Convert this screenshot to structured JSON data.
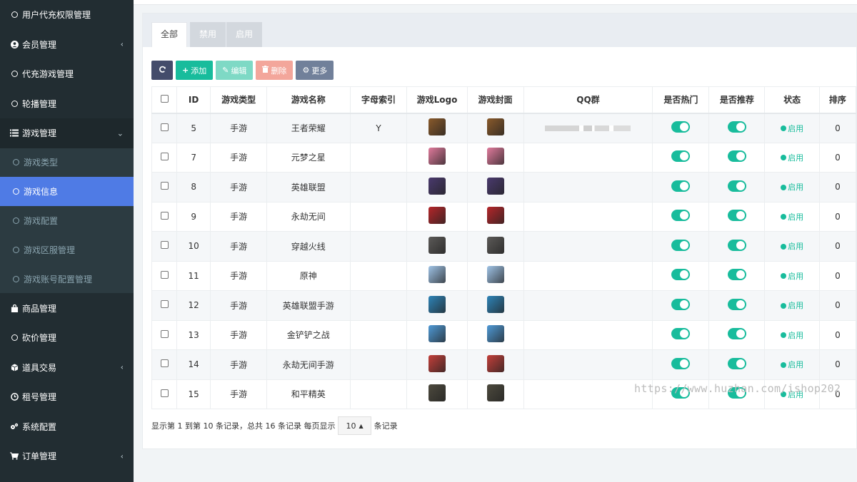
{
  "sidebar": {
    "items_top": [
      {
        "label": "用户代充权限管理",
        "icon": "circle-icon"
      },
      {
        "label": "会员管理",
        "icon": "user-circle-icon",
        "chevron": "‹"
      },
      {
        "label": "代充游戏管理",
        "icon": "circle-icon"
      },
      {
        "label": "轮播管理",
        "icon": "circle-icon"
      }
    ],
    "open_item": {
      "label": "游戏管理",
      "icon": "list-icon",
      "chevron": "⌄"
    },
    "sub_items": [
      {
        "label": "游戏类型"
      },
      {
        "label": "游戏信息",
        "active": true
      },
      {
        "label": "游戏配置"
      },
      {
        "label": "游戏区服管理"
      },
      {
        "label": "游戏账号配置管理"
      }
    ],
    "items_bottom": [
      {
        "label": "商品管理",
        "icon": "shopping-bag-icon"
      },
      {
        "label": "砍价管理",
        "icon": "circle-icon"
      },
      {
        "label": "道具交易",
        "icon": "cube-icon",
        "chevron": "‹"
      },
      {
        "label": "租号管理",
        "icon": "clock-icon"
      },
      {
        "label": "系统配置",
        "icon": "cogs-icon"
      },
      {
        "label": "订单管理",
        "icon": "cart-icon",
        "chevron": "‹"
      }
    ]
  },
  "tabs": [
    "全部",
    "禁用",
    "启用"
  ],
  "toolbar": {
    "add_label": "添加",
    "edit_label": "编辑",
    "delete_label": "删除",
    "more_label": "更多"
  },
  "table": {
    "columns": [
      "",
      "ID",
      "游戏类型",
      "游戏名称",
      "字母索引",
      "游戏Logo",
      "游戏封面",
      "QQ群",
      "是否热门",
      "是否推荐",
      "状态",
      "排序"
    ],
    "rows": [
      {
        "id": "5",
        "type": "手游",
        "name": "王者荣耀",
        "letter": "Y",
        "qq_blurred": true,
        "status": "启用",
        "sort": "0",
        "thumb_color": "#8a5a2b"
      },
      {
        "id": "7",
        "type": "手游",
        "name": "元梦之星",
        "letter": "",
        "qq_blurred": false,
        "status": "启用",
        "sort": "0",
        "thumb_color": "#e07a9c"
      },
      {
        "id": "8",
        "type": "手游",
        "name": "英雄联盟",
        "letter": "",
        "qq_blurred": false,
        "status": "启用",
        "sort": "0",
        "thumb_color": "#4a3a6e"
      },
      {
        "id": "9",
        "type": "手游",
        "name": "永劫无间",
        "letter": "",
        "qq_blurred": false,
        "status": "启用",
        "sort": "0",
        "thumb_color": "#b5262a"
      },
      {
        "id": "10",
        "type": "手游",
        "name": "穿越火线",
        "letter": "",
        "qq_blurred": false,
        "status": "启用",
        "sort": "0",
        "thumb_color": "#5c5a58"
      },
      {
        "id": "11",
        "type": "手游",
        "name": "原神",
        "letter": "",
        "qq_blurred": false,
        "status": "启用",
        "sort": "0",
        "thumb_color": "#9fc3e6"
      },
      {
        "id": "12",
        "type": "手游",
        "name": "英雄联盟手游",
        "letter": "",
        "qq_blurred": false,
        "status": "启用",
        "sort": "0",
        "thumb_color": "#2e84b8"
      },
      {
        "id": "13",
        "type": "手游",
        "name": "金铲铲之战",
        "letter": "",
        "qq_blurred": false,
        "status": "启用",
        "sort": "0",
        "thumb_color": "#4f9ad6"
      },
      {
        "id": "14",
        "type": "手游",
        "name": "永劫无间手游",
        "letter": "",
        "qq_blurred": false,
        "status": "启用",
        "sort": "0",
        "thumb_color": "#c33f3a"
      },
      {
        "id": "15",
        "type": "手游",
        "name": "和平精英",
        "letter": "",
        "qq_blurred": false,
        "status": "启用",
        "sort": "0",
        "thumb_color": "#4d4a3e"
      }
    ]
  },
  "pager": {
    "summary": "显示第 1 到第 10 条记录，总共 16 条记录 每页显示",
    "page_size": "10",
    "suffix": "条记录"
  },
  "watermark": "https://www.huzhan.com/ishop202",
  "colors": {
    "sidebar_bg": "#222d32",
    "active_sub": "#4f7be5",
    "accent_green": "#18bc9c"
  }
}
